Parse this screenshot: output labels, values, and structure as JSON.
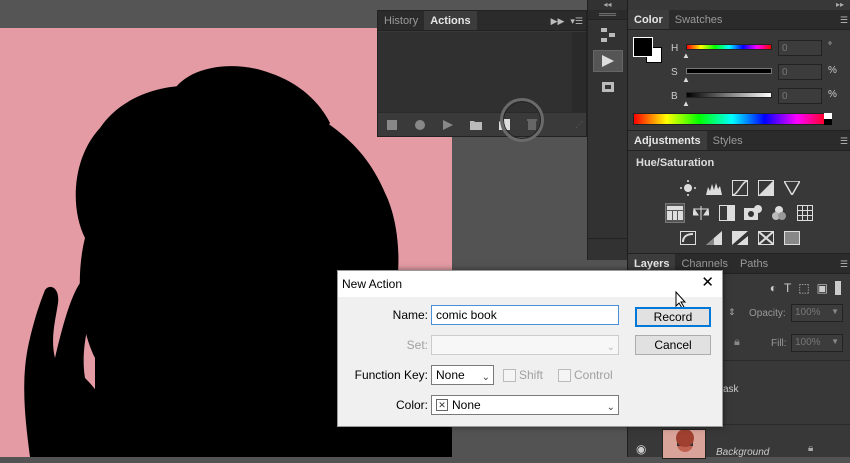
{
  "actions_panel": {
    "tabs": [
      {
        "label": "History"
      },
      {
        "label": "Actions"
      }
    ],
    "bottom_icons": [
      "stop-icon",
      "record-icon",
      "play-icon",
      "folder-icon",
      "new-action-icon",
      "trash-icon"
    ]
  },
  "tool_icons": [
    "histogram-icon",
    "play-icon",
    "cube-icon"
  ],
  "color_panel": {
    "tabs": [
      {
        "label": "Color"
      },
      {
        "label": "Swatches"
      }
    ],
    "sliders": [
      {
        "label": "H",
        "value": "0",
        "unit": "°"
      },
      {
        "label": "S",
        "value": "0",
        "unit": "%"
      },
      {
        "label": "B",
        "value": "0",
        "unit": "%"
      }
    ]
  },
  "adjustments_panel": {
    "tabs": [
      {
        "label": "Adjustments"
      },
      {
        "label": "Styles"
      }
    ],
    "heading": "Hue/Saturation"
  },
  "layers_panel": {
    "tabs": [
      {
        "label": "Layers"
      },
      {
        "label": "Channels"
      },
      {
        "label": "Paths"
      }
    ],
    "opacity_label": "Opacity:",
    "opacity_value": "100%",
    "fill_label": "Fill:",
    "fill_value": "100%",
    "mask_layer_partial": "ask",
    "background_layer": "Background"
  },
  "dialog": {
    "title": "New Action",
    "name_label": "Name:",
    "name_value": "comic book",
    "set_label": "Set:",
    "set_value": "",
    "function_key_label": "Function Key:",
    "function_key_value": "None",
    "shift_label": "Shift",
    "control_label": "Control",
    "color_label": "Color:",
    "color_value": "None",
    "record_label": "Record",
    "cancel_label": "Cancel"
  },
  "colors": {
    "canvas_pink": "#e49ba3",
    "panel_bg": "#383838",
    "dialog_bg": "#f0f0f0",
    "accent_blue": "#0078d7"
  }
}
